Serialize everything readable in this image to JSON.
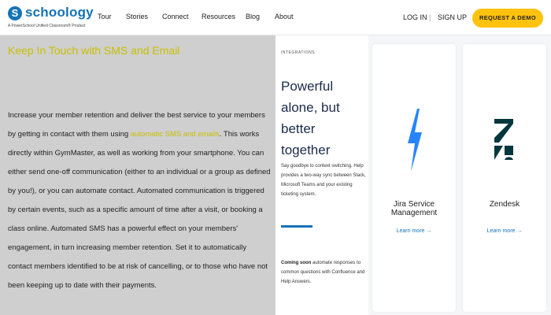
{
  "brand": {
    "name": "schoology",
    "mark": "S",
    "tagline": "A PowerSchool Unified Classroom® Product"
  },
  "nav": {
    "items": [
      "Tour",
      "Stories",
      "Connect",
      "Resources",
      "Blog",
      "About"
    ],
    "login": "LOG IN",
    "separator": "|",
    "signup": "SIGN UP",
    "demo": "REQUEST A DEMO"
  },
  "overlay": {
    "title": "Keep In Touch with SMS and Email",
    "body_before": "Increase your member retention and deliver the best service to your members by getting in contact with them using ",
    "body_highlight": "automatic SMS and emails",
    "body_after": ". This works directly within GymMaster, as well as working from your smartphone. You can either send one-off communication (either to an individual or a group as defined by you!), or you can automate contact. Automated communication is triggered by certain events, such as a specific amount of time after a visit, or booking a class online. Automated SMS has a powerful effect on your members' engagement, in turn increasing member retention. Set it to automatically contact members identified to be at risk of cancelling, or to those who have not been keeping up to date with their payments."
  },
  "integrations": {
    "kicker": "INTEGRATIONS",
    "heading": "Powerful alone, but better together",
    "description": "Say goodbye to context switching. Help provides a two-way sync between Slack, Microsoft Teams and your existing ticketing system.",
    "coming_soon_label": "Coming soon",
    "coming_soon_text": " automate responses to common questions with Confluence and Help Answers."
  },
  "cards": [
    {
      "title": "Jira Service Management",
      "link": "Learn more →",
      "icon": "jira-lightning-icon",
      "color": "#2684ff"
    },
    {
      "title": "Zendesk",
      "link": "Learn more →",
      "icon": "zendesk-z-icon",
      "color": "#03363d"
    }
  ],
  "colors": {
    "brand_blue": "#1573b6",
    "demo_yellow": "#ffc20e",
    "highlight_yellow": "#c8c000",
    "overlay_grey": "#cfcfcf"
  }
}
